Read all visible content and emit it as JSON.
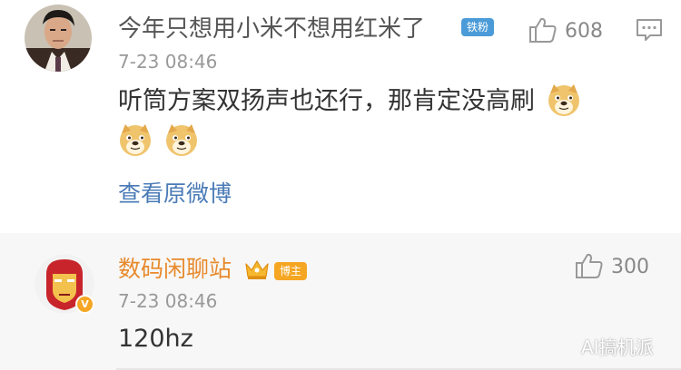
{
  "comment": {
    "username": "今年只想用小米不想用红米了",
    "badge": "铁粉",
    "like_count": "608",
    "time": "7-23 08:46",
    "text": "听筒方案双扬声也还行，那肯定没高刷",
    "view_original": "查看原微博"
  },
  "reply": {
    "username": "数码闲聊站",
    "badge": "博主",
    "verified_mark": "V",
    "like_count": "300",
    "time": "7-23 08:46",
    "text": "120hz"
  },
  "watermark": "AI搞机派",
  "icons": {
    "like": "thumbs-up-icon",
    "comment": "comment-icon",
    "crown": "crown-icon",
    "doge": "doge-emoji-icon"
  },
  "colors": {
    "text": "#333333",
    "meta": "#999999",
    "link": "#4a7bb7",
    "vip_name": "#e88a2c",
    "fan_badge": "#4a9bd8",
    "blogger_badge": "#f5a623",
    "reply_bg": "#f7f7f7"
  }
}
